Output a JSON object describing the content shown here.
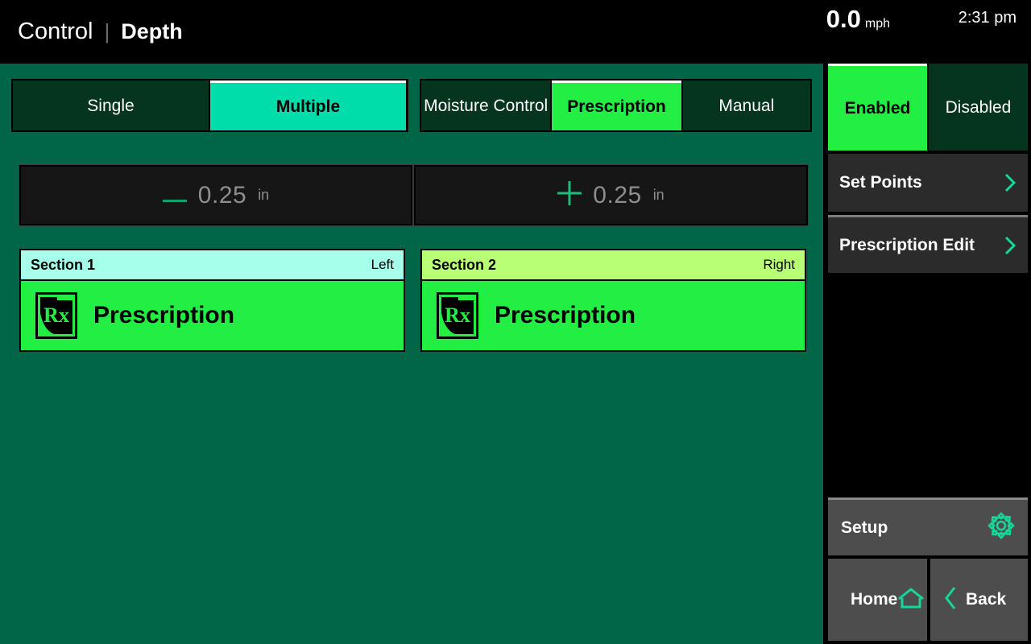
{
  "header": {
    "title_main": "Control",
    "title_separator": "|",
    "title_sub": "Depth",
    "speed_value": "0.0",
    "speed_unit": "mph",
    "clock": "2:31 pm"
  },
  "mode_tabs": {
    "items": [
      {
        "label": "Single",
        "selected": false
      },
      {
        "label": "Multiple",
        "selected": true
      }
    ]
  },
  "control_tabs": {
    "items": [
      {
        "label": "Moisture Control",
        "selected": false
      },
      {
        "label": "Prescription",
        "selected": true
      },
      {
        "label": "Manual",
        "selected": false
      }
    ]
  },
  "steppers": {
    "decrement": {
      "icon": "minus-icon",
      "sign": "—",
      "value": "0.25",
      "unit": "in"
    },
    "increment": {
      "icon": "plus-icon",
      "sign": "+",
      "value": "0.25",
      "unit": "in"
    }
  },
  "sections": [
    {
      "title": "Section 1",
      "side": "Right-or-Left",
      "side_label": "Left",
      "mode_label": "Prescription",
      "icon": "prescription-map-icon",
      "header_color": "#a6ffe8",
      "body_color": "#22ee44"
    },
    {
      "title": "Section 2",
      "side_label": "Right",
      "mode_label": "Prescription",
      "icon": "prescription-map-icon",
      "header_color": "#b8ff75",
      "body_color": "#22ee44"
    }
  ],
  "sidebar": {
    "enable_toggle": {
      "items": [
        {
          "label": "Enabled",
          "selected": true
        },
        {
          "label": "Disabled",
          "selected": false
        }
      ]
    },
    "menu_items": [
      {
        "label": "Set Points",
        "icon": "chevron-right-icon"
      },
      {
        "label": "Prescription Edit",
        "icon": "chevron-right-icon"
      }
    ],
    "setup": {
      "label": "Setup",
      "icon": "gear-icon"
    },
    "home": {
      "label": "Home",
      "icon": "home-icon"
    },
    "back": {
      "label": "Back",
      "icon": "chevron-left-icon"
    }
  },
  "colors": {
    "background": "#006647",
    "tab_off": "#05351f",
    "accent_teal": "#00dcaa",
    "accent_green": "#22ee44",
    "icon_teal": "#14d79a",
    "panel_gray": "#2b2b2b",
    "button_gray": "#4d4d4d"
  }
}
